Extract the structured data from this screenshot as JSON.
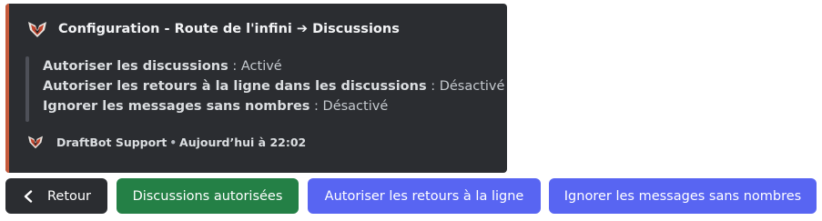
{
  "embed": {
    "accent_color": "#c65a3c",
    "author_icon": "draftbot-logo-icon",
    "title": "Configuration - Route de l'infini ➔ Discussions",
    "lines": [
      {
        "label": "Autoriser les discussions",
        "sep": " : ",
        "value": "Activé"
      },
      {
        "label": "Autoriser les retours à la ligne dans les discussions",
        "sep": " : ",
        "value": "Désactivé"
      },
      {
        "label": "Ignorer les messages sans nombres",
        "sep": " : ",
        "value": "Désactivé"
      }
    ],
    "footer": {
      "icon": "draftbot-logo-icon",
      "text": "DraftBot Support",
      "dot": "•",
      "timestamp": "Aujourd’hui à 22:02"
    }
  },
  "buttons": {
    "back": {
      "label": "Retour",
      "icon": "chevron-left-icon",
      "color": "#2b2d31"
    },
    "discussions": {
      "label": "Discussions autorisées",
      "color": "#248046"
    },
    "line_breaks": {
      "label": "Autoriser les retours à la ligne",
      "color": "#5865f2"
    },
    "ignore": {
      "label": "Ignorer les messages sans nombres",
      "color": "#5865f2"
    }
  }
}
